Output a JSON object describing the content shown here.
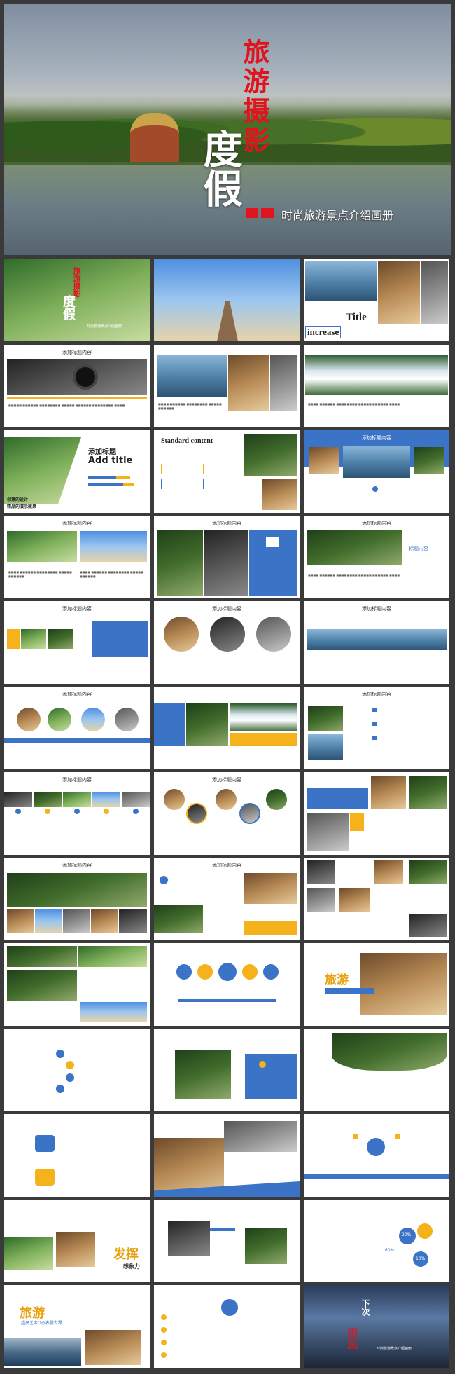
{
  "cover": {
    "title_vertical": "旅游摄影",
    "title_big": "度假",
    "subtitle": "时尚旅游景点介绍画册"
  },
  "slides": {
    "header": "添加标题内容",
    "s3_title": "Title",
    "s3_sub": "increase",
    "s7_add": "添加标题",
    "s7_add_en": "Add title",
    "s7_caption1": "创意的设计",
    "s7_caption2": "精品的演示效果",
    "s8_title": "Standard content",
    "s9_header": "添加标题内容",
    "s12_label": "标题内容",
    "s14_box": "添加标题内容",
    "s34_brand": "旅游",
    "s34_brand2": "超高艺术O态表服世界",
    "s39_fa": "发挥",
    "s39_xiang": "想象力",
    "s44_a": "下次",
    "s44_b": "再见",
    "s44_sub": "时尚旅游景点介绍画册",
    "s32_brand": "旅游",
    "percent_a": "20%",
    "percent_b": "60%",
    "percent_c": "10%"
  }
}
